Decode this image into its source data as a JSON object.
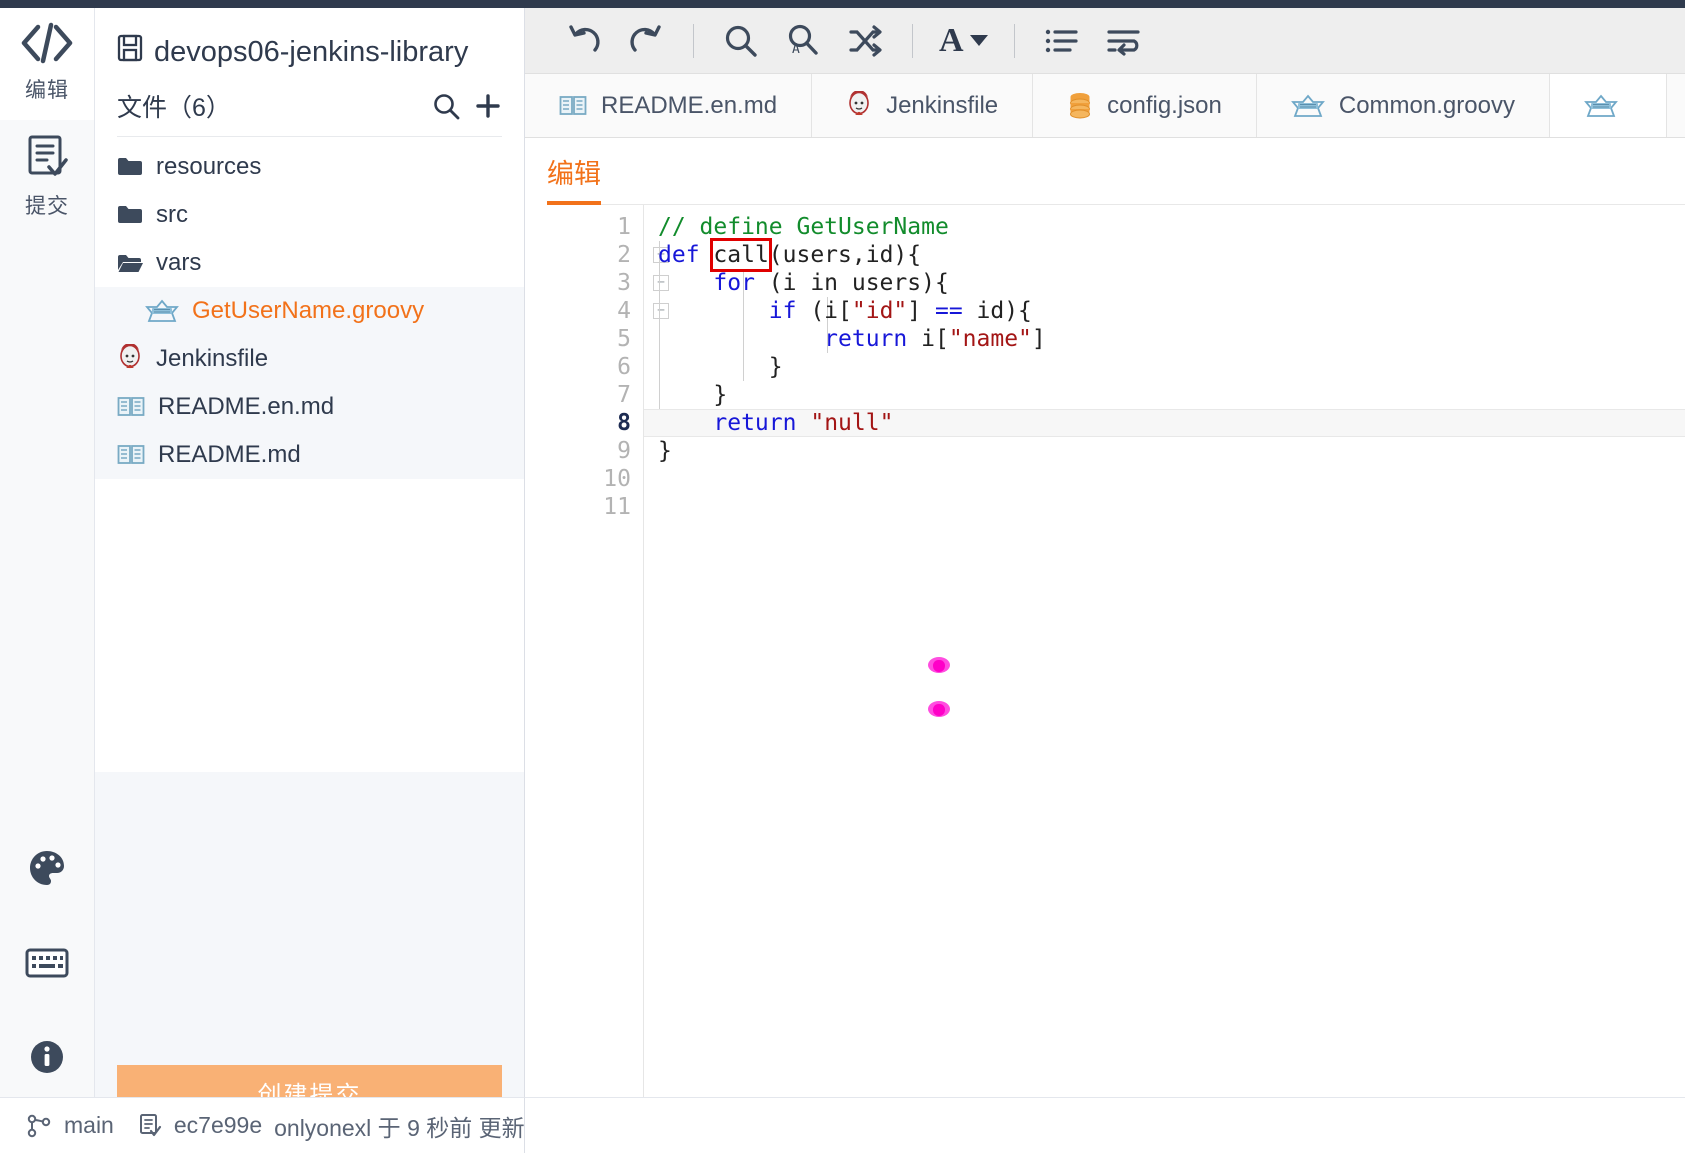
{
  "rail": {
    "items": [
      {
        "label": "编辑",
        "icon": "code-brackets-icon",
        "active": true
      },
      {
        "label": "提交",
        "icon": "commit-document-icon",
        "active": false
      }
    ],
    "bottom_icons": [
      {
        "icon": "palette-icon"
      },
      {
        "icon": "keyboard-icon"
      },
      {
        "icon": "info-icon"
      }
    ]
  },
  "filepanel": {
    "repo_name": "devops06-jenkins-library",
    "repo_icon": "save-book-icon",
    "files_header": "文件（6）",
    "search_icon": "search-icon",
    "add_icon": "plus-icon",
    "items": [
      {
        "label": "resources",
        "icon": "folder-closed-icon",
        "indent": false,
        "selected": false
      },
      {
        "label": "src",
        "icon": "folder-closed-icon",
        "indent": false,
        "selected": false
      },
      {
        "label": "vars",
        "icon": "folder-open-icon",
        "indent": false,
        "selected": false
      },
      {
        "label": "GetUserName.groovy",
        "icon": "groovy-icon",
        "indent": true,
        "selected": true
      },
      {
        "label": "Jenkinsfile",
        "icon": "jenkins-icon",
        "indent": false,
        "selected": false
      },
      {
        "label": "README.en.md",
        "icon": "markdown-book-icon",
        "indent": false,
        "selected": false
      },
      {
        "label": "README.md",
        "icon": "markdown-book-icon",
        "indent": false,
        "selected": false
      }
    ],
    "commit_button": "创建提交"
  },
  "toolbar": {
    "buttons": [
      {
        "name": "undo-icon",
        "title": "undo"
      },
      {
        "name": "redo-icon",
        "title": "redo"
      },
      {
        "name": "search-icon",
        "title": "search"
      },
      {
        "name": "search-replace-icon",
        "title": "replace"
      },
      {
        "name": "shuffle-icon",
        "title": "shuffle"
      },
      {
        "name": "font-icon",
        "title": "font"
      },
      {
        "name": "list-icon",
        "title": "list"
      },
      {
        "name": "wrap-lines-icon",
        "title": "wrap"
      }
    ]
  },
  "tabs": [
    {
      "label": "README.en.md",
      "icon": "markdown-book-icon",
      "active": false
    },
    {
      "label": "Jenkinsfile",
      "icon": "jenkins-icon",
      "active": false
    },
    {
      "label": "config.json",
      "icon": "database-icon",
      "active": false
    },
    {
      "label": "Common.groovy",
      "icon": "groovy-icon",
      "active": false
    },
    {
      "label": "",
      "icon": "groovy-icon",
      "active": true
    }
  ],
  "editor": {
    "mode_tab": "编辑",
    "accent_color": "#f2721a",
    "current_line": 8,
    "highlight_token": "call",
    "line_numbers": [
      1,
      2,
      3,
      4,
      5,
      6,
      7,
      8,
      9,
      10,
      11
    ],
    "fold_lines": [
      2,
      3,
      4
    ],
    "code_lines": [
      "// define GetUserName",
      "def call(users,id){",
      "    for (i in users){",
      "        if (i[\"id\"] == id){",
      "            return i[\"name\"]",
      "        }",
      "    }",
      "    return \"null\"",
      "}",
      "",
      ""
    ]
  },
  "statusbar": {
    "branch_icon": "git-branch-icon",
    "branch": "main",
    "commit_icon": "commit-document-icon",
    "commit_hash": "ec7e99e",
    "author_and_time": "onlyonexl 于 9 秒前 更新"
  }
}
